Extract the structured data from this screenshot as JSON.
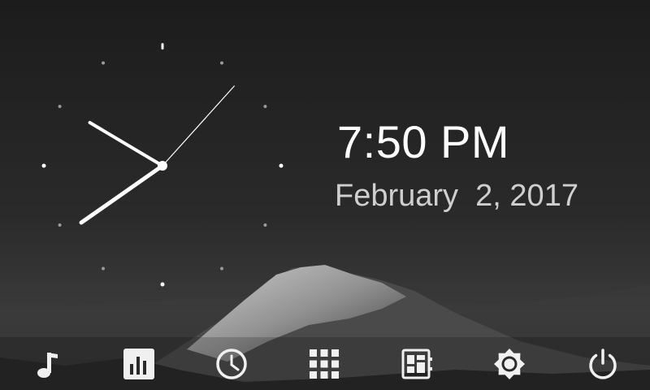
{
  "clock": {
    "hour": 7,
    "minute": 50,
    "second": 7
  },
  "time_text": "7:50 PM",
  "date_text": "February  2, 2017",
  "dock": {
    "items": [
      {
        "name": "music-icon"
      },
      {
        "name": "equalizer-icon"
      },
      {
        "name": "clock-icon"
      },
      {
        "name": "app-grid-icon"
      },
      {
        "name": "dashboard-widget-icon"
      },
      {
        "name": "brightness-icon"
      },
      {
        "name": "power-icon"
      }
    ]
  },
  "colors": {
    "background": "#1f1f1f",
    "text": "#ffffff",
    "date_text": "#cfcfcf",
    "icon": "#f0f0f0"
  }
}
